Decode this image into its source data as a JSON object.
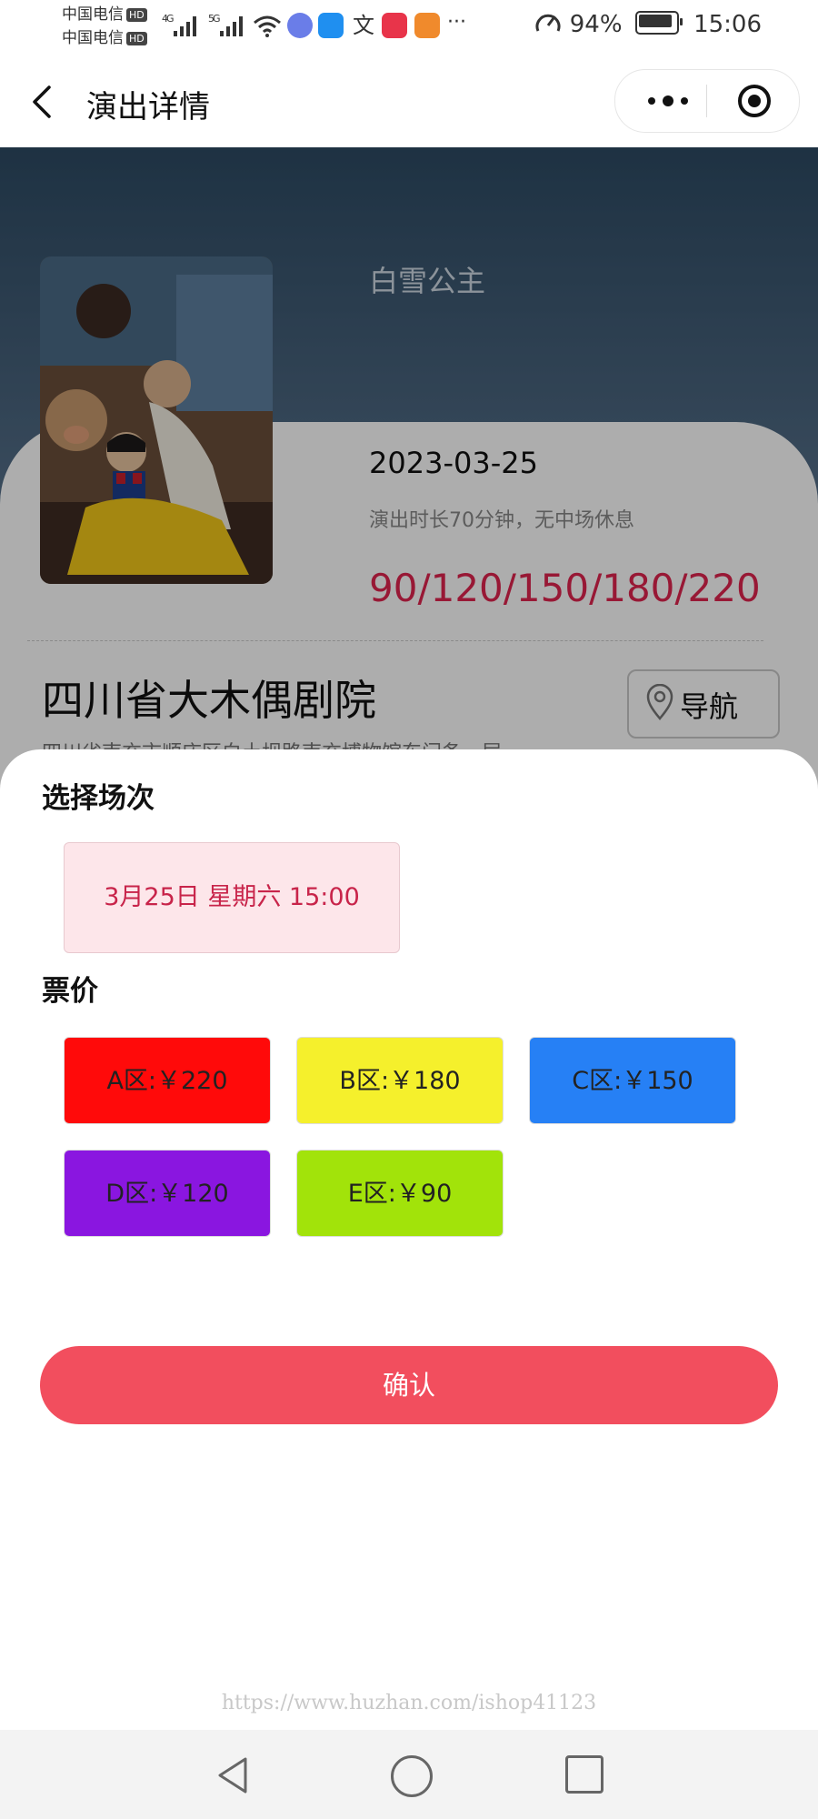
{
  "status_bar": {
    "carrier1": "中国电信",
    "carrier2": "中国电信",
    "hd_badge": "HD",
    "net1": "4G",
    "net2": "5G",
    "more": "···",
    "battery": "94%",
    "time": "15:06"
  },
  "nav": {
    "title": "演出详情"
  },
  "show": {
    "title": "白雪公主",
    "date": "2023-03-25",
    "duration": "演出时长70分钟，无中场休息",
    "prices": "90/120/150/180/220"
  },
  "venue": {
    "name": "四川省大木偶剧院",
    "nav_label": "导航",
    "address": "四川省南充市顺庆区白土坝路南充博物馆东门备一层"
  },
  "sheet": {
    "session_title": "选择场次",
    "session": "3月25日 星期六 15:00",
    "price_title": "票价",
    "prices": [
      {
        "label": "A区:￥220",
        "color": "#ff0a0a"
      },
      {
        "label": "B区:￥180",
        "color": "#f5f02c"
      },
      {
        "label": "C区:￥150",
        "color": "#2680f5"
      },
      {
        "label": "D区:￥120",
        "color": "#8a16e0"
      },
      {
        "label": "E区:￥90",
        "color": "#a2e30a"
      }
    ],
    "confirm": "确认"
  },
  "watermark": "https://www.huzhan.com/ishop41123",
  "colors": {
    "accent": "#f24e5e",
    "price_red": "#e0244e"
  }
}
